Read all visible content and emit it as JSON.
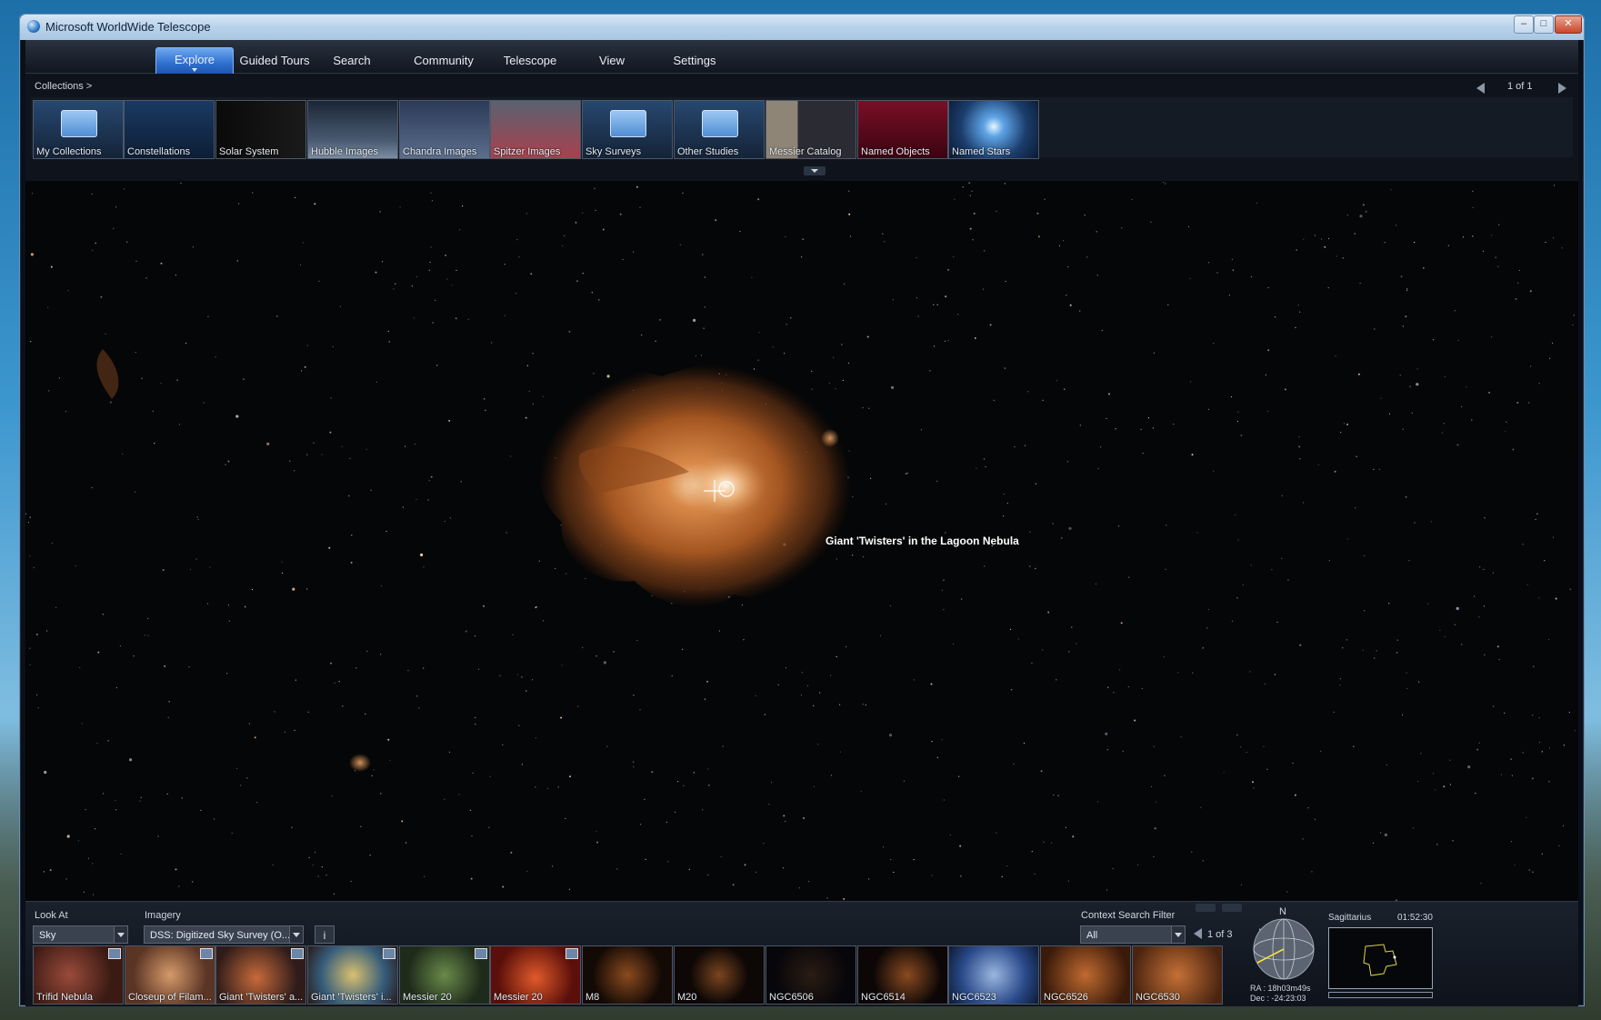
{
  "window": {
    "title": "Microsoft WorldWide Telescope"
  },
  "window_controls": {
    "minimize": "–",
    "maximize": "□",
    "close": "✕"
  },
  "menu": {
    "tabs": [
      {
        "label": "Explore",
        "active": true
      },
      {
        "label": "Guided Tours"
      },
      {
        "label": "Search"
      },
      {
        "label": "Community"
      },
      {
        "label": "Telescope"
      },
      {
        "label": "View"
      },
      {
        "label": "Settings"
      }
    ]
  },
  "collections": {
    "breadcrumb": "Collections  >",
    "pager": "1 of 1",
    "items": [
      {
        "label": "My Collections",
        "icon": "folder-icon"
      },
      {
        "label": "Constellations",
        "icon": "constellation-icon"
      },
      {
        "label": "Solar System",
        "icon": "planets-icon"
      },
      {
        "label": "Hubble Images",
        "icon": "hubble-icon"
      },
      {
        "label": "Chandra Images",
        "icon": "chandra-icon"
      },
      {
        "label": "Spitzer Images",
        "icon": "spitzer-icon"
      },
      {
        "label": "Sky Surveys",
        "icon": "folder-icon"
      },
      {
        "label": "Other Studies",
        "icon": "folder-icon"
      },
      {
        "label": "Messier Catalog",
        "icon": "messier-icon"
      },
      {
        "label": "Named Objects",
        "icon": "horsehead-icon"
      },
      {
        "label": "Named Stars",
        "icon": "star-icon"
      }
    ]
  },
  "sky_view": {
    "object_label": "Giant 'Twisters' in the Lagoon Nebula"
  },
  "bottom": {
    "look_at_label": "Look At",
    "look_at_value": "Sky",
    "imagery_label": "Imagery",
    "imagery_value": "DSS: Digitized Sky Survey (O...",
    "info_button": "i",
    "context_filter_label": "Context Search Filter",
    "context_filter_value": "All",
    "context_pager": "1 of 3",
    "results": [
      {
        "label": "Trifid Nebula",
        "badge": true
      },
      {
        "label": "Closeup of Filam...",
        "badge": true
      },
      {
        "label": "Giant 'Twisters' a...",
        "badge": true
      },
      {
        "label": "Giant 'Twisters' i...",
        "badge": true
      },
      {
        "label": "Messier 20",
        "badge": true
      },
      {
        "label": "Messier 20",
        "badge": true
      },
      {
        "label": "M8",
        "badge": false
      },
      {
        "label": "M20",
        "badge": false
      },
      {
        "label": "NGC6506",
        "badge": false
      },
      {
        "label": "NGC6514",
        "badge": false
      },
      {
        "label": "NGC6523",
        "badge": false
      },
      {
        "label": "NGC6526",
        "badge": false
      },
      {
        "label": "NGC6530",
        "badge": false
      }
    ],
    "compass": {
      "north": "N",
      "ra": "RA :  18h03m49s",
      "dec": "Dec :  -24:23:03"
    },
    "minimap": {
      "constellation": "Sagittarius",
      "time": "01:52:30"
    }
  },
  "colors": {
    "accent": "#2f6fd0",
    "nebula": "#b5652a",
    "background": "#050607"
  }
}
